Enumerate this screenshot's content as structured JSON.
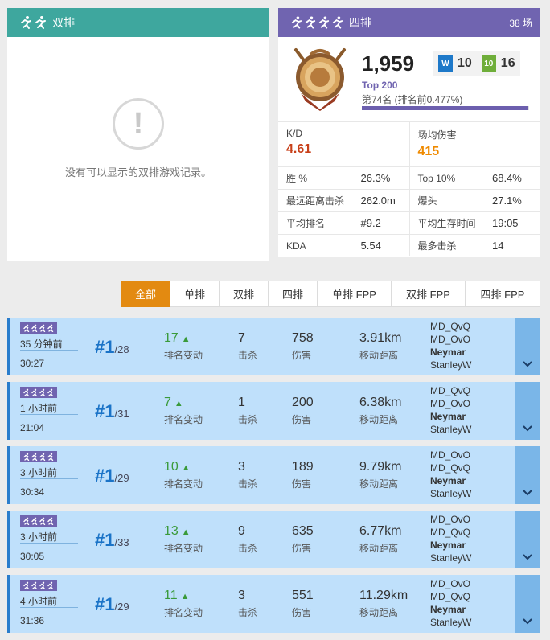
{
  "duo_card": {
    "title": "双排",
    "empty_icon": "!",
    "empty_text": "没有可以显示的双排游戏记录。"
  },
  "squad_card": {
    "title": "四排",
    "games": "38 场",
    "rating": "1,959",
    "wins": "10",
    "top10": "16",
    "wins_icon_text": "W",
    "top10_icon_text": "10",
    "top_label": "Top 200",
    "rank_text": "第74名 (排名前0.477%)",
    "rank_progress": 0.995,
    "kd": {
      "label": "K/D",
      "value": "4.61"
    },
    "avg_dmg": {
      "label": "场均伤害",
      "value": "415"
    },
    "rows": [
      {
        "l1": "胜 %",
        "v1": "26.3%",
        "l2": "Top 10%",
        "v2": "68.4%"
      },
      {
        "l1": "最远距离击杀",
        "v1": "262.0m",
        "l2": "爆头",
        "v2": "27.1%"
      },
      {
        "l1": "平均排名",
        "v1": "#9.2",
        "l2": "平均生存时间",
        "v2": "19:05"
      },
      {
        "l1": "KDA",
        "v1": "5.54",
        "l2": "最多击杀",
        "v2": "14"
      }
    ]
  },
  "tabs": [
    "全部",
    "单排",
    "双排",
    "四排",
    "单排 FPP",
    "双排 FPP",
    "四排 FPP"
  ],
  "match_labels": {
    "rank_change": "排名变动",
    "kills": "击杀",
    "damage": "伤害",
    "distance": "移动距离"
  },
  "matches": [
    {
      "time": "35 分钟前",
      "duration": "30:27",
      "place": "#1",
      "total": "/28",
      "rank_change": "17",
      "kills": "7",
      "damage": "758",
      "distance": "3.91km",
      "team": [
        "MD_QvQ",
        "MD_OvO",
        "Neymar",
        "StanleyW"
      ]
    },
    {
      "time": "1 小时前",
      "duration": "21:04",
      "place": "#1",
      "total": "/31",
      "rank_change": "7",
      "kills": "1",
      "damage": "200",
      "distance": "6.38km",
      "team": [
        "MD_QvQ",
        "MD_OvO",
        "Neymar",
        "StanleyW"
      ]
    },
    {
      "time": "3 小时前",
      "duration": "30:34",
      "place": "#1",
      "total": "/29",
      "rank_change": "10",
      "kills": "3",
      "damage": "189",
      "distance": "9.79km",
      "team": [
        "MD_OvO",
        "MD_QvQ",
        "Neymar",
        "StanleyW"
      ]
    },
    {
      "time": "3 小时前",
      "duration": "30:05",
      "place": "#1",
      "total": "/33",
      "rank_change": "13",
      "kills": "9",
      "damage": "635",
      "distance": "6.77km",
      "team": [
        "MD_OvO",
        "MD_QvQ",
        "Neymar",
        "StanleyW"
      ]
    },
    {
      "time": "4 小时前",
      "duration": "31:36",
      "place": "#1",
      "total": "/29",
      "rank_change": "11",
      "kills": "3",
      "damage": "551",
      "distance": "11.29km",
      "team": [
        "MD_OvO",
        "MD_QvQ",
        "Neymar",
        "StanleyW"
      ]
    }
  ],
  "colors": {
    "duo": "#3ea79e",
    "squad": "#7064b0",
    "active_tab": "#e38a11",
    "row_bg": "#bfe0fb",
    "place": "#1a73c7"
  },
  "icons": {
    "runner": "runner-icon",
    "expand": "chevron-down-icon",
    "empty": "exclamation-icon",
    "badge": "rank-badge-icon"
  }
}
